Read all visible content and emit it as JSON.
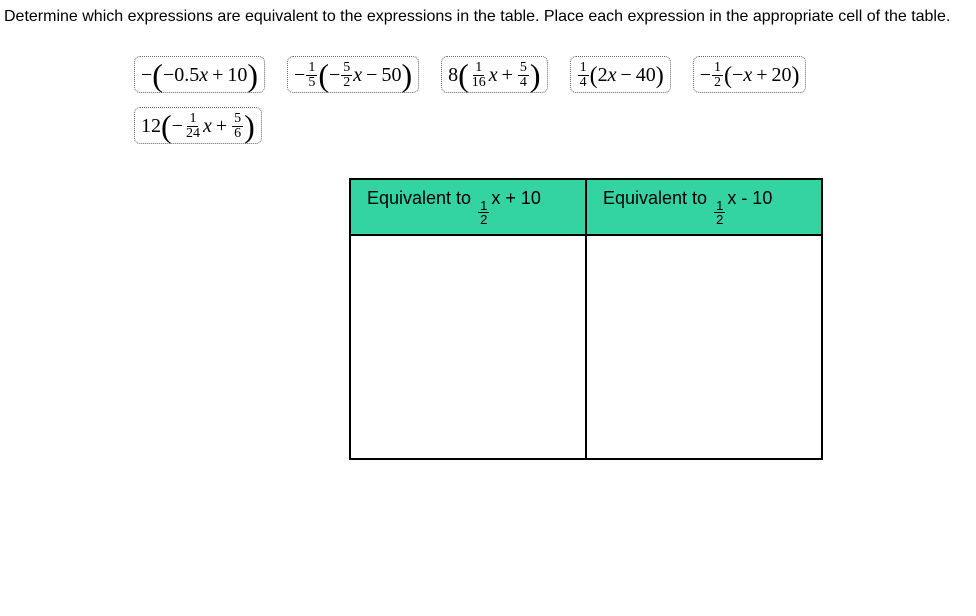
{
  "instruction": "Determine which expressions are equivalent to the expressions in the table. Place each expression in the appropriate cell of the table.",
  "chips": {
    "a": {
      "body": "−(−0.5x + 10)"
    },
    "b": {
      "lead_neg": "−",
      "f1n": "1",
      "f1d": "5",
      "f2n": "5",
      "f2d": "2",
      "tail": " − 50"
    },
    "c": {
      "lead": "8",
      "f1n": "1",
      "f1d": "16",
      "f2n": "5",
      "f2d": "4"
    },
    "d": {
      "f1n": "1",
      "f1d": "4",
      "body": "(2x − 40)"
    },
    "e": {
      "lead_neg": "−",
      "f1n": "1",
      "f1d": "2",
      "body": "(−x + 20)"
    },
    "f": {
      "lead": "12",
      "f1n": "1",
      "f1d": "24",
      "f2n": "5",
      "f2d": "6"
    }
  },
  "table": {
    "col1": {
      "prefix": "Equivalent to ",
      "fn": "1",
      "fd": "2",
      "suffix": "x + 10"
    },
    "col2": {
      "prefix": "Equivalent to ",
      "fn": "1",
      "fd": "2",
      "suffix": "x - 10"
    }
  }
}
